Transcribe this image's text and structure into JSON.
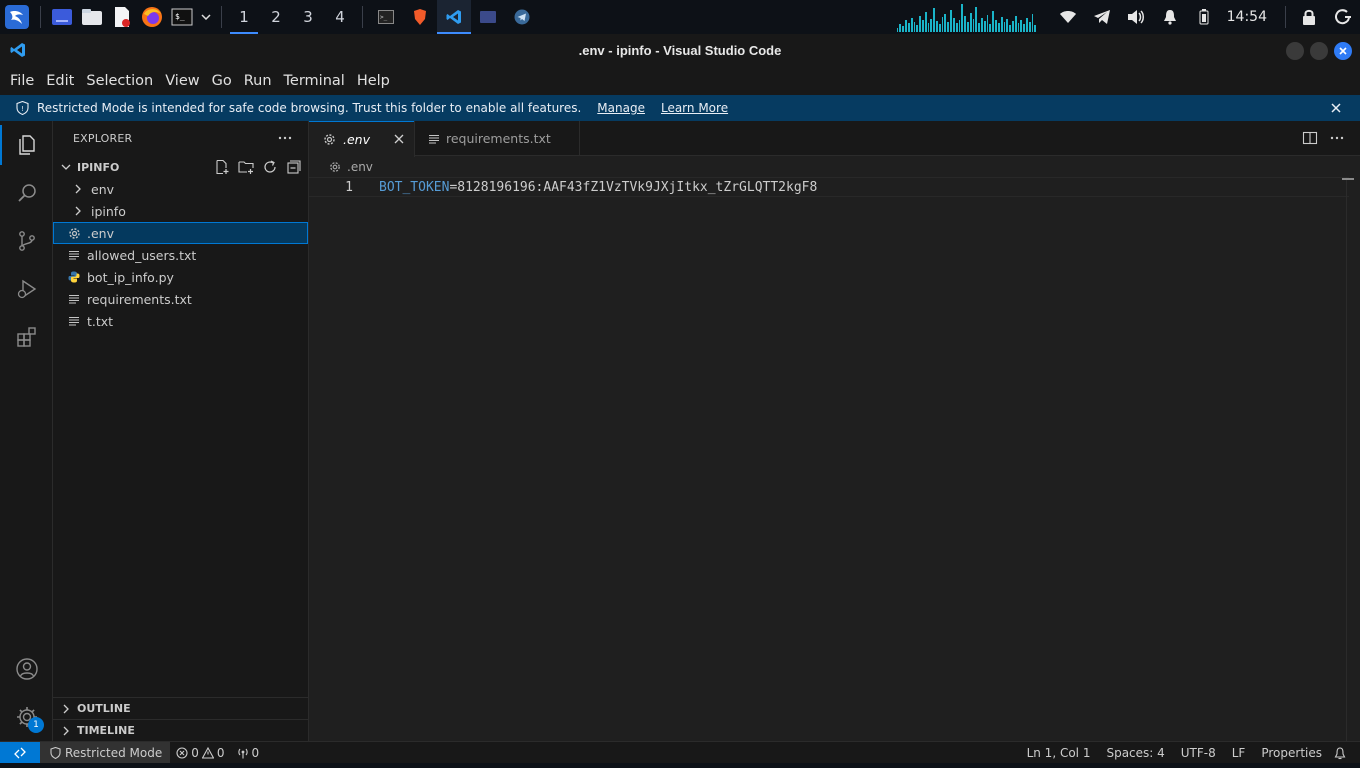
{
  "taskbar": {
    "workspaces": [
      "1",
      "2",
      "3",
      "4"
    ],
    "active_workspace": "1",
    "clock": "14:54",
    "accent": "#3d8bfd"
  },
  "window": {
    "title": ".env - ipinfo - Visual Studio Code"
  },
  "menu": [
    "File",
    "Edit",
    "Selection",
    "View",
    "Go",
    "Run",
    "Terminal",
    "Help"
  ],
  "banner": {
    "text": "Restricted Mode is intended for safe code browsing. Trust this folder to enable all features.",
    "manage": "Manage",
    "learn_more": "Learn More",
    "color": "#063b61"
  },
  "activity_bar": {
    "items": [
      "explorer-icon",
      "search-icon",
      "source-control-icon",
      "run-debug-icon",
      "extensions-icon"
    ],
    "bottom": [
      "account-icon",
      "manage-gear-icon"
    ],
    "settings_badge": "1"
  },
  "sidebar": {
    "title": "EXPLORER",
    "folder": "IPINFO",
    "items": [
      {
        "label": "env",
        "type": "folder"
      },
      {
        "label": "ipinfo",
        "type": "folder"
      },
      {
        "label": ".env",
        "type": "settings-file",
        "selected": true
      },
      {
        "label": "allowed_users.txt",
        "type": "text-file"
      },
      {
        "label": "bot_ip_info.py",
        "type": "python-file"
      },
      {
        "label": "requirements.txt",
        "type": "text-file"
      },
      {
        "label": "t.txt",
        "type": "text-file"
      }
    ],
    "outline": "OUTLINE",
    "timeline": "TIMELINE"
  },
  "editor": {
    "tabs": [
      {
        "label": ".env",
        "active": true
      },
      {
        "label": "requirements.txt",
        "active": false
      }
    ],
    "breadcrumb": ".env",
    "lines": [
      {
        "number": "1",
        "key": "BOT_TOKEN",
        "rest": "=8128196196:AAF43fZ1VzTVk9JXjItkx_tZrGLQTT2kgF8"
      }
    ]
  },
  "statusbar": {
    "restricted": "Restricted Mode",
    "errors": "0",
    "warnings": "0",
    "ports": "0",
    "position": "Ln 1, Col 1",
    "spaces": "Spaces: 4",
    "encoding": "UTF-8",
    "eol": "LF",
    "language": "Properties",
    "accent": "#0078d4"
  }
}
